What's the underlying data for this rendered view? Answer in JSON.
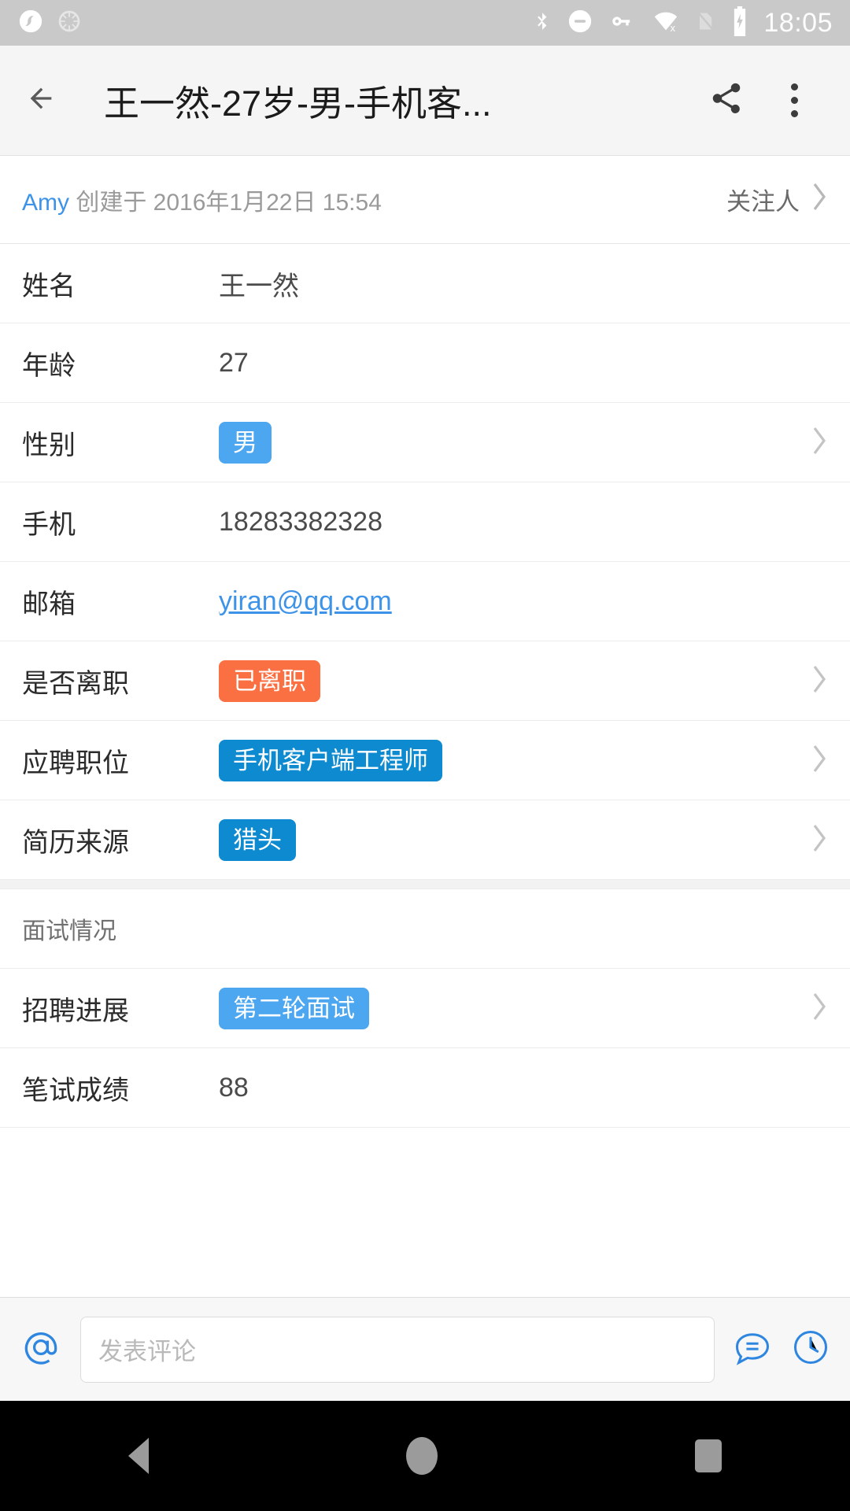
{
  "status_bar": {
    "time": "18:05",
    "left_icons": [
      "app-notification-icon",
      "sync-icon"
    ],
    "right_icons": [
      "bluetooth-icon",
      "do-not-disturb-icon",
      "vpn-key-icon",
      "wifi-off-icon",
      "sim-card-missing-icon",
      "battery-charging-icon"
    ]
  },
  "app_bar": {
    "back_icon": "back-arrow-icon",
    "title": "王一然-27岁-男-手机客...",
    "share_icon": "share-icon",
    "overflow_icon": "more-vertical-icon"
  },
  "meta": {
    "author": "Amy",
    "created_text": "创建于 2016年1月22日 15:54",
    "follower_label": "关注人",
    "chevron_icon": "chevron-right-icon"
  },
  "fields": [
    {
      "label": "姓名",
      "value": "王一然",
      "type": "text",
      "chevron": false
    },
    {
      "label": "年龄",
      "value": "27",
      "type": "text",
      "chevron": false
    },
    {
      "label": "性别",
      "value": "男",
      "type": "badge",
      "badge_color": "#4CA6F0",
      "chevron": true
    },
    {
      "label": "手机",
      "value": "18283382328",
      "type": "text",
      "chevron": false
    },
    {
      "label": "邮箱",
      "value": "yiran@qq.com",
      "type": "link",
      "chevron": false
    },
    {
      "label": "是否离职",
      "value": "已离职",
      "type": "badge",
      "badge_color": "#FA7042",
      "chevron": true
    },
    {
      "label": "应聘职位",
      "value": "手机客户端工程师",
      "type": "badge",
      "badge_color": "#0E8BD0",
      "chevron": true
    },
    {
      "label": "简历来源",
      "value": "猎头",
      "type": "badge",
      "badge_color": "#0E8BD0",
      "chevron": true
    }
  ],
  "section": {
    "title": "面试情况"
  },
  "interview_fields": [
    {
      "label": "招聘进展",
      "value": "第二轮面试",
      "type": "badge",
      "badge_color": "#4CA6F0",
      "chevron": true
    },
    {
      "label": "笔试成绩",
      "value": "88",
      "type": "text",
      "chevron": false
    }
  ],
  "comment_bar": {
    "mention_icon": "at-mention-icon",
    "placeholder": "发表评论",
    "comment_icon": "comment-bubble-icon",
    "history_icon": "clock-history-icon"
  },
  "nav_bar": {
    "back_icon": "nav-back-icon",
    "home_icon": "nav-home-icon",
    "recents_icon": "nav-recents-icon"
  },
  "colors": {
    "accent_blue": "#3d93e8",
    "badge_blue_light": "#4CA6F0",
    "badge_blue_dark": "#0E8BD0",
    "badge_orange": "#FA7042"
  }
}
